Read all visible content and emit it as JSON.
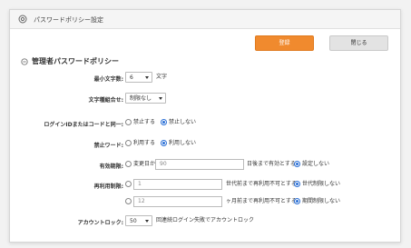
{
  "window": {
    "title": "パスワードポリシー設定"
  },
  "buttons": {
    "login": "登録",
    "close": "閉じる"
  },
  "section": {
    "title": "管理者パスワードポリシー"
  },
  "min_length": {
    "label": "最小文字数:",
    "value": "6",
    "suffix": "文字"
  },
  "char_combo": {
    "label": "文字種組合せ:",
    "value": "制限なし"
  },
  "login_id": {
    "label": "ログインIDまたはコードと同一:",
    "opt_forbid": "禁止する",
    "opt_allow": "禁止しない",
    "selected": "禁止しない"
  },
  "forbidden_word": {
    "label": "禁止ワード:",
    "opt_use": "利用する",
    "opt_nouse": "利用しない",
    "selected": "利用しない"
  },
  "expiry": {
    "label": "有効期限:",
    "opt_from": "変更日から",
    "days": "90",
    "days_suffix": "日後まで有効とする",
    "opt_none": "設定しない",
    "selected": "設定しない"
  },
  "reuse": {
    "label": "再利用制限:",
    "row1": {
      "value": "1",
      "suffix": "世代前まで再利用不可とする",
      "opt_none": "世代制限しない",
      "selected": "世代制限しない"
    },
    "row2": {
      "value": "12",
      "suffix": "ヶ月前まで再利用不可とする",
      "opt_none": "期間制限しない",
      "selected": "期間制限しない"
    }
  },
  "lockout": {
    "label": "アカウントロック:",
    "value": "50",
    "suffix": "回連続ログイン失敗でアカウントロック"
  },
  "colors": {
    "accent": "#f08a2e",
    "radio": "#2a6fd6"
  }
}
